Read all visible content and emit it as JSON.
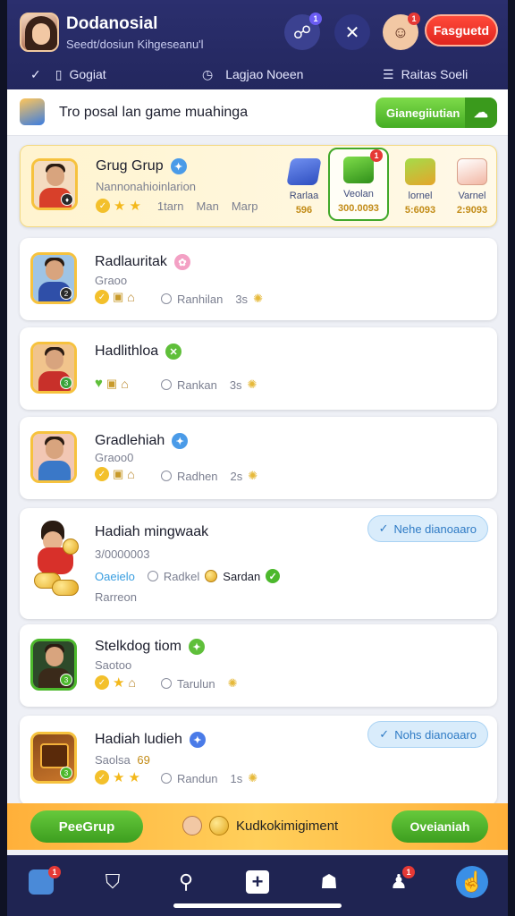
{
  "header": {
    "title": "Dodanosial",
    "subtitle": "Seedt/dosiun Kihgeseanu'l",
    "cta_label": "Fasguetd",
    "badge_1": "1",
    "badge_2": "1"
  },
  "tabs": [
    {
      "label": "Gogiat",
      "icon": "check-icon"
    },
    {
      "label": "Lagjao Noeen",
      "icon": "clock-icon"
    },
    {
      "label": "Raitas Soeli",
      "icon": "list-icon"
    }
  ],
  "promo": {
    "text": "Tro posal lan game muahinga",
    "button_label": "Gianegiiutian"
  },
  "featured": {
    "name": "Grug Grup",
    "subtitle": "Nannonahioinlarion",
    "meta": [
      "1tarn",
      "Man",
      "Marp"
    ],
    "slots": [
      {
        "label": "Rarlaa",
        "value": "596"
      },
      {
        "label": "Veolan",
        "value": "300.0093",
        "badge": "1"
      },
      {
        "label": "lornel",
        "value": "5:6093"
      },
      {
        "label": "Varnel",
        "value": "2:9093"
      }
    ]
  },
  "list": [
    {
      "name": "Radlauritak",
      "subtitle": "Graoo",
      "meta": "Ranhilan",
      "meta_extra": "3s",
      "level": "2"
    },
    {
      "name": "Hadlithloa",
      "subtitle": "",
      "meta": "Rankan",
      "meta_extra": "3s",
      "level": "3"
    },
    {
      "name": "Gradlehiah",
      "subtitle": "Graoo0",
      "meta": "Radhen",
      "meta_extra": "2s",
      "level": ""
    }
  ],
  "reward_card": {
    "name": "Hadiah mingwaak",
    "subtitle": "3/0000003",
    "link": "Oaeielo",
    "meta": "Radkel",
    "status": "Sardan",
    "footer": "Rarreon",
    "pill": "Nehe dianoaaro"
  },
  "list2": [
    {
      "name": "Stelkdog tiom",
      "subtitle": "Saotoo",
      "meta": "Tarulun",
      "meta_extra": "",
      "level": "3"
    },
    {
      "name": "Hadiah ludieh",
      "subtitle": "Saolsa",
      "subtitle_extra": "69",
      "meta": "Randun",
      "meta_extra": "1s",
      "pill": "Nohs dianoaaro",
      "level": "3"
    }
  ],
  "action_bar": {
    "left_label": "PeeGrup",
    "mid_label": "Kudkokimigiment",
    "right_label": "Oveianiah"
  },
  "nav": {
    "badge_profile": "1",
    "badge_friends": "1"
  },
  "colors": {
    "header_bg": "#2b2f6e",
    "accent_red": "#e0241e",
    "accent_green": "#45ad24",
    "gold": "#f3c02b",
    "pill_blue": "#2f7bc5"
  }
}
